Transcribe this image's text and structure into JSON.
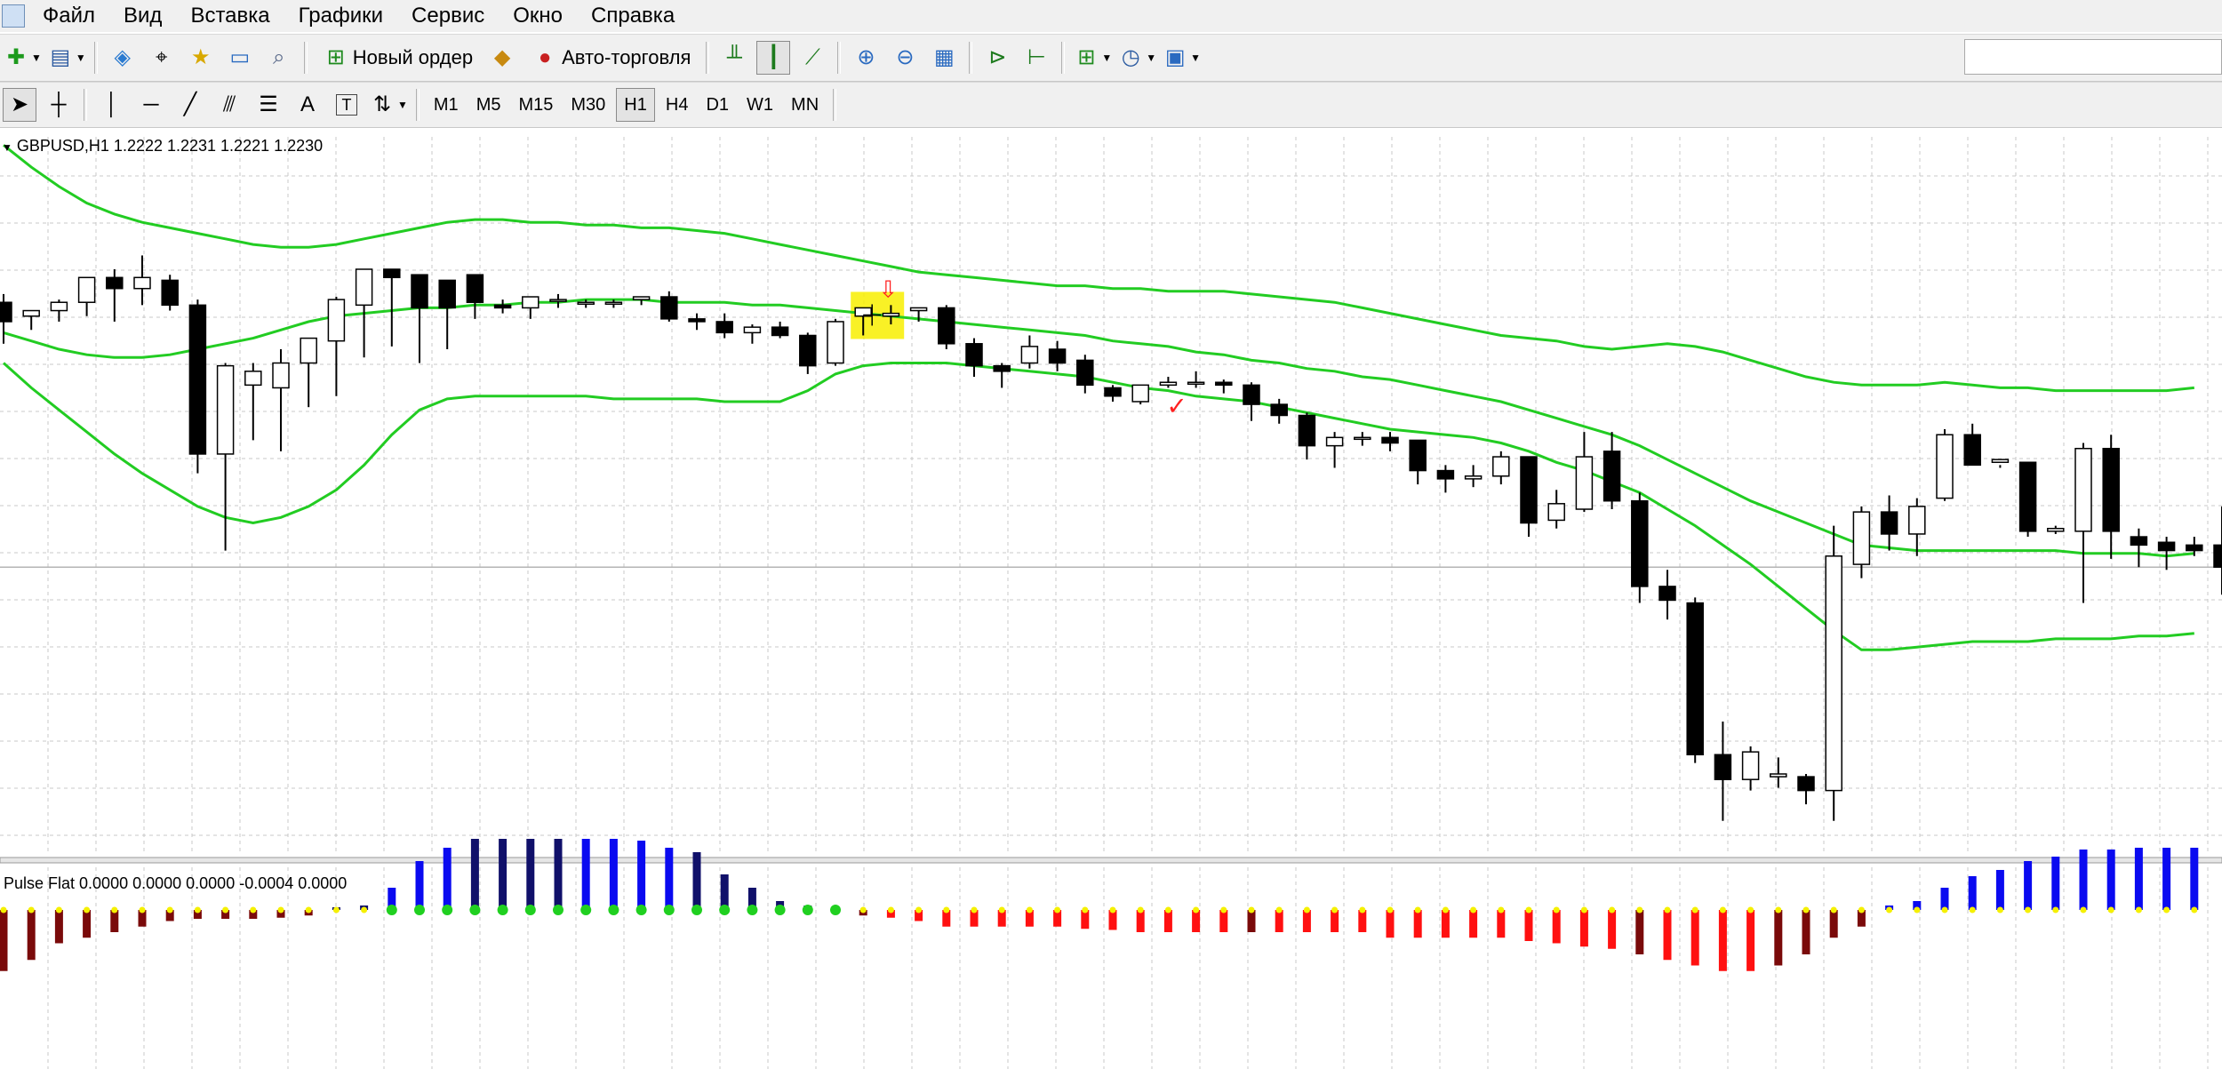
{
  "menu": [
    "Файл",
    "Вид",
    "Вставка",
    "Графики",
    "Сервис",
    "Окно",
    "Справка"
  ],
  "toolbar": {
    "new_order_label": "Новый ордер",
    "auto_trading_label": "Авто-торговля"
  },
  "timeframes": [
    "M1",
    "M5",
    "M15",
    "M30",
    "H1",
    "H4",
    "D1",
    "W1",
    "MN"
  ],
  "active_timeframe": "H1",
  "drawing_tools": {
    "text_tool": "A",
    "label_tool": "T"
  },
  "chart": {
    "symbol_header": "GBPUSD,H1  1.2222 1.2231 1.2221 1.2230",
    "indicator_header": "Pulse Flat 0.0000 0.0000 0.0000 -0.0004 0.0000"
  },
  "chart_data": [
    {
      "type": "candlestick",
      "title": "GBPUSD,H1",
      "series": [
        {
          "name": "candles",
          "ohlc": [
            [
              1.228,
              1.2283,
              1.2265,
              1.2273
            ],
            [
              1.2275,
              1.2277,
              1.227,
              1.2277
            ],
            [
              1.2277,
              1.2281,
              1.2273,
              1.228
            ],
            [
              1.228,
              1.2289,
              1.2275,
              1.2289
            ],
            [
              1.2289,
              1.2292,
              1.2273,
              1.2285
            ],
            [
              1.2285,
              1.2297,
              1.2279,
              1.2289
            ],
            [
              1.2288,
              1.229,
              1.2277,
              1.2279
            ],
            [
              1.2279,
              1.2281,
              1.2218,
              1.2225
            ],
            [
              1.2225,
              1.2258,
              1.219,
              1.2257
            ],
            [
              1.225,
              1.2258,
              1.223,
              1.2255
            ],
            [
              1.2249,
              1.2263,
              1.2226,
              1.2258
            ],
            [
              1.2258,
              1.2262,
              1.2242,
              1.2267
            ],
            [
              1.2266,
              1.2282,
              1.2246,
              1.2281
            ],
            [
              1.2279,
              1.2291,
              1.226,
              1.2292
            ],
            [
              1.2292,
              1.2292,
              1.2264,
              1.2289
            ],
            [
              1.229,
              1.229,
              1.2258,
              1.2278
            ],
            [
              1.2288,
              1.2288,
              1.2263,
              1.2278
            ],
            [
              1.229,
              1.229,
              1.2274,
              1.228
            ],
            [
              1.2279,
              1.2281,
              1.2276,
              1.2278
            ],
            [
              1.2278,
              1.2279,
              1.2274,
              1.2282
            ],
            [
              1.2281,
              1.2283,
              1.2278,
              1.2281
            ],
            [
              1.228,
              1.2281,
              1.2278,
              1.228
            ],
            [
              1.228,
              1.2281,
              1.2278,
              1.228
            ],
            [
              1.2281,
              1.2282,
              1.2279,
              1.2282
            ],
            [
              1.2282,
              1.2284,
              1.2273,
              1.2274
            ],
            [
              1.2274,
              1.2276,
              1.227,
              1.2273
            ],
            [
              1.2273,
              1.2276,
              1.2267,
              1.2269
            ],
            [
              1.2269,
              1.2272,
              1.2265,
              1.2271
            ],
            [
              1.2271,
              1.2273,
              1.2267,
              1.2268
            ],
            [
              1.2268,
              1.2269,
              1.2254,
              1.2257
            ],
            [
              1.2258,
              1.2274,
              1.2257,
              1.2273
            ],
            [
              1.2275,
              1.2278,
              1.2268,
              1.2278
            ],
            [
              1.2275,
              1.2279,
              1.2272,
              1.2276
            ],
            [
              1.2277,
              1.2278,
              1.2273,
              1.2278
            ],
            [
              1.2278,
              1.2279,
              1.2263,
              1.2265
            ],
            [
              1.2265,
              1.2267,
              1.2253,
              1.2257
            ],
            [
              1.2257,
              1.2258,
              1.2249,
              1.2255
            ],
            [
              1.2258,
              1.2268,
              1.2256,
              1.2264
            ],
            [
              1.2263,
              1.2266,
              1.2255,
              1.2258
            ],
            [
              1.2259,
              1.2261,
              1.2247,
              1.225
            ],
            [
              1.2249,
              1.225,
              1.2244,
              1.2246
            ],
            [
              1.2244,
              1.225,
              1.2243,
              1.225
            ],
            [
              1.225,
              1.2253,
              1.2249,
              1.2251
            ],
            [
              1.2251,
              1.2255,
              1.2249,
              1.2251
            ],
            [
              1.2251,
              1.2252,
              1.2247,
              1.225
            ],
            [
              1.225,
              1.2251,
              1.2237,
              1.2243
            ],
            [
              1.2243,
              1.2245,
              1.2236,
              1.2239
            ],
            [
              1.2239,
              1.224,
              1.2223,
              1.2228
            ],
            [
              1.2228,
              1.2233,
              1.222,
              1.2231
            ],
            [
              1.2231,
              1.2233,
              1.2228,
              1.2231
            ],
            [
              1.2231,
              1.2233,
              1.2226,
              1.2229
            ],
            [
              1.223,
              1.223,
              1.2214,
              1.2219
            ],
            [
              1.2219,
              1.2221,
              1.2211,
              1.2216
            ],
            [
              1.2216,
              1.2221,
              1.2213,
              1.2217
            ],
            [
              1.2217,
              1.2226,
              1.2214,
              1.2224
            ],
            [
              1.2224,
              1.2224,
              1.2195,
              1.22
            ],
            [
              1.2201,
              1.2212,
              1.2198,
              1.2207
            ],
            [
              1.2205,
              1.2233,
              1.2204,
              1.2224
            ],
            [
              1.2226,
              1.2233,
              1.2205,
              1.2208
            ],
            [
              1.2208,
              1.2211,
              1.2171,
              1.2177
            ],
            [
              1.2177,
              1.2183,
              1.2165,
              1.2172
            ],
            [
              1.2171,
              1.2173,
              1.2113,
              1.2116
            ],
            [
              1.2116,
              1.2128,
              1.2092,
              1.2107
            ],
            [
              1.2107,
              1.2119,
              1.2103,
              1.2117
            ],
            [
              1.2108,
              1.2115,
              1.2104,
              1.2109
            ],
            [
              1.2108,
              1.2109,
              1.2098,
              1.2103
            ],
            [
              1.2103,
              1.2199,
              1.2092,
              1.2188
            ],
            [
              1.2185,
              1.2206,
              1.218,
              1.2204
            ],
            [
              1.2204,
              1.221,
              1.219,
              1.2196
            ],
            [
              1.2196,
              1.2209,
              1.2188,
              1.2206
            ],
            [
              1.2209,
              1.2234,
              1.2208,
              1.2232
            ],
            [
              1.2232,
              1.2236,
              1.2222,
              1.2221
            ],
            [
              1.2222,
              1.2221,
              1.222,
              1.2223
            ],
            [
              1.2222,
              1.2222,
              1.2195,
              1.2197
            ],
            [
              1.2197,
              1.2199,
              1.2196,
              1.2198
            ],
            [
              1.2197,
              1.2229,
              1.2171,
              1.2227
            ],
            [
              1.2227,
              1.2232,
              1.2187,
              1.2197
            ],
            [
              1.2195,
              1.2198,
              1.2184,
              1.2192
            ],
            [
              1.2193,
              1.2195,
              1.2183,
              1.219
            ],
            [
              1.2192,
              1.2195,
              1.2188,
              1.219
            ],
            [
              1.2192,
              1.2206,
              1.2174,
              1.2184
            ]
          ]
        },
        {
          "name": "upper_band",
          "values": [
            1.2337,
            1.2329,
            1.2322,
            1.2316,
            1.2312,
            1.2309,
            1.2307,
            1.2305,
            1.2303,
            1.2301,
            1.23,
            1.23,
            1.2301,
            1.2303,
            1.2305,
            1.2307,
            1.2309,
            1.231,
            1.231,
            1.2309,
            1.2309,
            1.2308,
            1.2308,
            1.2307,
            1.2307,
            1.2306,
            1.2305,
            1.2303,
            1.2301,
            1.2299,
            1.2297,
            1.2295,
            1.2293,
            1.2291,
            1.229,
            1.2289,
            1.2288,
            1.2287,
            1.2286,
            1.2286,
            1.2285,
            1.2285,
            1.2284,
            1.2284,
            1.2284,
            1.2283,
            1.2282,
            1.2281,
            1.228,
            1.2278,
            1.2276,
            1.2274,
            1.2272,
            1.227,
            1.2268,
            1.2267,
            1.2266,
            1.2264,
            1.2263,
            1.2264,
            1.2265,
            1.2264,
            1.2262,
            1.2259,
            1.2256,
            1.2253,
            1.2251,
            1.225,
            1.225,
            1.225,
            1.2251,
            1.225,
            1.2249,
            1.2249,
            1.2248,
            1.2248,
            1.2248,
            1.2248,
            1.2248,
            1.2249
          ]
        },
        {
          "name": "middle_band",
          "values": [
            1.2269,
            1.2266,
            1.2263,
            1.2261,
            1.226,
            1.226,
            1.2261,
            1.2263,
            1.2265,
            1.2267,
            1.227,
            1.2273,
            1.2275,
            1.2276,
            1.2277,
            1.2278,
            1.2278,
            1.2279,
            1.2279,
            1.228,
            1.228,
            1.2281,
            1.2281,
            1.2281,
            1.228,
            1.228,
            1.228,
            1.2279,
            1.2279,
            1.2278,
            1.2277,
            1.2276,
            1.2275,
            1.2274,
            1.2273,
            1.2272,
            1.2271,
            1.227,
            1.2269,
            1.2268,
            1.2266,
            1.2265,
            1.2264,
            1.2262,
            1.2261,
            1.2259,
            1.2258,
            1.2256,
            1.2255,
            1.2253,
            1.2252,
            1.225,
            1.2248,
            1.2246,
            1.2244,
            1.2241,
            1.2238,
            1.2235,
            1.2232,
            1.2228,
            1.2223,
            1.2218,
            1.2213,
            1.2208,
            1.2204,
            1.22,
            1.2196,
            1.2192,
            1.2191,
            1.219,
            1.219,
            1.219,
            1.219,
            1.219,
            1.219,
            1.2189,
            1.2189,
            1.2189,
            1.2188,
            1.2189
          ]
        },
        {
          "name": "lower_band",
          "values": [
            1.2258,
            1.2249,
            1.2241,
            1.2233,
            1.2225,
            1.2218,
            1.2212,
            1.2206,
            1.2202,
            1.22,
            1.2202,
            1.2206,
            1.2212,
            1.2221,
            1.2232,
            1.2241,
            1.2245,
            1.2246,
            1.2246,
            1.2246,
            1.2246,
            1.2246,
            1.2245,
            1.2245,
            1.2245,
            1.2245,
            1.2244,
            1.2244,
            1.2244,
            1.2248,
            1.2254,
            1.2257,
            1.2258,
            1.2258,
            1.2258,
            1.2257,
            1.2256,
            1.2255,
            1.2254,
            1.2253,
            1.2251,
            1.2249,
            1.2248,
            1.2246,
            1.2245,
            1.2244,
            1.2242,
            1.224,
            1.2238,
            1.2236,
            1.2234,
            1.2233,
            1.2232,
            1.2231,
            1.2229,
            1.2226,
            1.2222,
            1.2219,
            1.2215,
            1.2211,
            1.2205,
            1.2199,
            1.2192,
            1.2185,
            1.2177,
            1.2169,
            1.2161,
            1.2154,
            1.2154,
            1.2155,
            1.2156,
            1.2157,
            1.2157,
            1.2157,
            1.2158,
            1.2158,
            1.2158,
            1.2159,
            1.2159,
            1.216
          ]
        }
      ],
      "signal": {
        "index": 31,
        "direction": "down"
      },
      "check_mark": {
        "index": 42
      },
      "y_range": [
        1.208,
        1.234
      ],
      "grid": true
    },
    {
      "type": "histogram",
      "title": "Pulse Flat",
      "colors": {
        "up": "#0a0af0",
        "up_weak": "#10106a",
        "down": "#ff1010",
        "down_weak": "#7a0a0a",
        "dot_yellow": "#f5f000",
        "dot_green": "#20d020"
      },
      "values": [
        -0.55,
        -0.45,
        -0.3,
        -0.25,
        -0.2,
        -0.15,
        -0.1,
        -0.08,
        -0.08,
        -0.08,
        -0.07,
        -0.05,
        0.03,
        0.05,
        0.25,
        0.55,
        0.7,
        0.8,
        0.8,
        0.8,
        0.8,
        0.8,
        0.8,
        0.78,
        0.7,
        0.65,
        0.4,
        0.25,
        0.1,
        0.05,
        0.0,
        -0.05,
        -0.07,
        -0.1,
        -0.15,
        -0.15,
        -0.15,
        -0.15,
        -0.15,
        -0.17,
        -0.18,
        -0.2,
        -0.2,
        -0.2,
        -0.2,
        -0.2,
        -0.2,
        -0.2,
        -0.2,
        -0.2,
        -0.25,
        -0.25,
        -0.25,
        -0.25,
        -0.25,
        -0.28,
        -0.3,
        -0.33,
        -0.35,
        -0.4,
        -0.45,
        -0.5,
        -0.55,
        -0.55,
        -0.5,
        -0.4,
        -0.25,
        -0.15,
        0.05,
        0.1,
        0.25,
        0.38,
        0.45,
        0.55,
        0.6,
        0.68,
        0.68,
        0.7,
        0.7,
        0.7
      ],
      "weak_flags": [
        1,
        1,
        1,
        1,
        1,
        1,
        1,
        1,
        1,
        1,
        1,
        1,
        1,
        1,
        0,
        0,
        0,
        1,
        1,
        1,
        1,
        0,
        0,
        0,
        0,
        1,
        1,
        1,
        1,
        1,
        1,
        1,
        0,
        0,
        0,
        0,
        0,
        0,
        0,
        0,
        0,
        0,
        0,
        0,
        0,
        1,
        0,
        0,
        0,
        0,
        0,
        0,
        0,
        0,
        0,
        0,
        0,
        0,
        0,
        1,
        0,
        0,
        0,
        0,
        1,
        1,
        1,
        1,
        0,
        0,
        0,
        0,
        0,
        0,
        0,
        0,
        0,
        0,
        0,
        0
      ],
      "dot_color": [
        "y",
        "y",
        "y",
        "y",
        "y",
        "y",
        "y",
        "y",
        "y",
        "y",
        "y",
        "y",
        "y",
        "y",
        "g",
        "g",
        "g",
        "g",
        "g",
        "g",
        "g",
        "g",
        "g",
        "g",
        "g",
        "g",
        "g",
        "g",
        "g",
        "g",
        "g",
        "y",
        "y",
        "y",
        "y",
        "y",
        "y",
        "y",
        "y",
        "y",
        "y",
        "y",
        "y",
        "y",
        "y",
        "y",
        "y",
        "y",
        "y",
        "y",
        "y",
        "y",
        "y",
        "y",
        "y",
        "y",
        "y",
        "y",
        "y",
        "y",
        "y",
        "y",
        "y",
        "y",
        "y",
        "y",
        "y",
        "y",
        "y",
        "y",
        "y",
        "y",
        "y",
        "y",
        "y",
        "y",
        "y",
        "y",
        "y",
        "y"
      ],
      "y_range": [
        -1.0,
        1.0
      ]
    }
  ]
}
